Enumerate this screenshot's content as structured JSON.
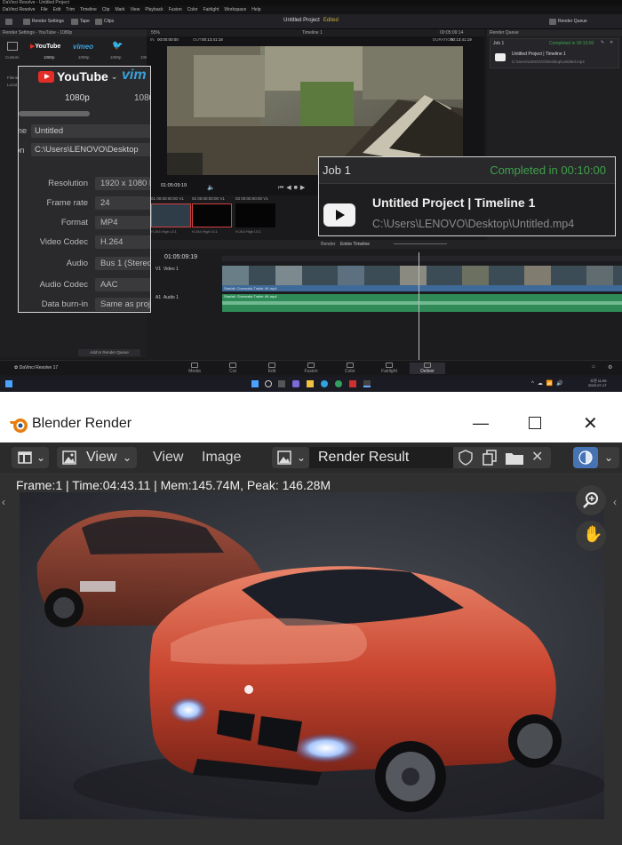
{
  "davinci": {
    "window_title": "DaVinci Resolve - Untitled Project",
    "menu": [
      "DaVinci Resolve",
      "File",
      "Edit",
      "Trim",
      "Timeline",
      "Clip",
      "Mark",
      "View",
      "Playback",
      "Fusion",
      "Color",
      "Fairlight",
      "Workspace",
      "Help"
    ],
    "toolbar": {
      "render_settings": "Render Settings",
      "tape": "Tape",
      "clips": "Clips",
      "project_name": "Untitled Project",
      "edited": "Edited",
      "render_queue": "Render Queue"
    },
    "render_settings": {
      "panel_title": "Render Settings - YouTube - 1080p",
      "presets": [
        {
          "label": "Custom"
        },
        {
          "label": "1080p"
        },
        {
          "label": "1080p"
        },
        {
          "label": "1080p"
        },
        {
          "label": "1080"
        }
      ],
      "zoom_tabs": {
        "youtube": "YouTube",
        "vimeo": "vim",
        "res1": "1080p",
        "res2": "1080"
      },
      "name_label": "me",
      "name_value": "Untitled",
      "location_label": "on",
      "location_value": "C:\\Users\\LENOVO\\Desktop",
      "fields": [
        {
          "label": "Resolution",
          "value": "1920 x 1080 HD"
        },
        {
          "label": "Frame rate",
          "value": "24"
        },
        {
          "label": "Format",
          "value": "MP4"
        },
        {
          "label": "Video Codec",
          "value": "H.264"
        },
        {
          "label": "Audio",
          "value": "Bus 1 (Stereo)"
        },
        {
          "label": "Audio Codec",
          "value": "AAC"
        },
        {
          "label": "Data burn-in",
          "value": "Same as project"
        }
      ],
      "add_to_queue": "Add to Render Queue"
    },
    "viewer": {
      "zoom": "55%",
      "timeline_name": "Timeline 1",
      "in": "00:00:00:00",
      "out": "00:13:41:18",
      "duration_label": "DURATION",
      "duration": "00:13:41:19",
      "timecode_right": "00:05:09:14",
      "timecode": "01:05:09:19"
    },
    "clips": [
      {
        "id": "01",
        "tc": "00:00:00:00",
        "track": "V1",
        "codec": "H.264 High L5.1"
      },
      {
        "id": "02",
        "tc": "00:00:00:00",
        "track": "V1",
        "codec": "H.264 High L5.1"
      },
      {
        "id": "03",
        "tc": "00:00:00:00",
        "track": "V1",
        "codec": "H.264 High L5.1"
      }
    ],
    "timeline": {
      "render_label": "Render",
      "render_mode": "Entire Timeline",
      "timecode": "01:05:09:19",
      "video_track": "Video 1",
      "video_track_id": "V1",
      "audio_track": "Audio 1",
      "audio_track_id": "A1",
      "clip_name_v": "Starfall: Cinematic Trailer 4K.mp4",
      "clip_name_a": "Starfall: Cinematic Trailer 4K.mp4"
    },
    "render_queue": {
      "panel_title": "Render Queue",
      "job_small": "Job 1",
      "job_small_status": "Completed in 00:10:00",
      "job_small_name": "Untitled Project | Timeline 1",
      "job_small_path": "C:\\Users\\LENOVO\\Desktop\\Untitled.mp4"
    },
    "job_zoom": {
      "job": "Job 1",
      "status": "Completed in 00:10:00",
      "name": "Untitled Project | Timeline 1",
      "path": "C:\\Users\\LENOVO\\Desktop\\Untitled.mp4"
    },
    "pages": [
      "Media",
      "Cut",
      "Edit",
      "Fusion",
      "Color",
      "Fairlight",
      "Deliver"
    ],
    "brand": "DaVinci Resolve 17",
    "clock_time": "오전 11:09",
    "clock_date": "2022-07-17"
  },
  "blender": {
    "window_title": "Blender Render",
    "header": {
      "view_dropdown": "View",
      "view_menu": "View",
      "image_menu": "Image",
      "image_name": "Render Result"
    },
    "status": "Frame:1 | Time:04:43.11 | Mem:145.74M, Peak: 146.28M"
  },
  "colors": {
    "resolve_bg": "#1a1a1c",
    "completed_green": "#3fa04a",
    "blender_bg": "#303030",
    "car_red": "#c9452f"
  }
}
